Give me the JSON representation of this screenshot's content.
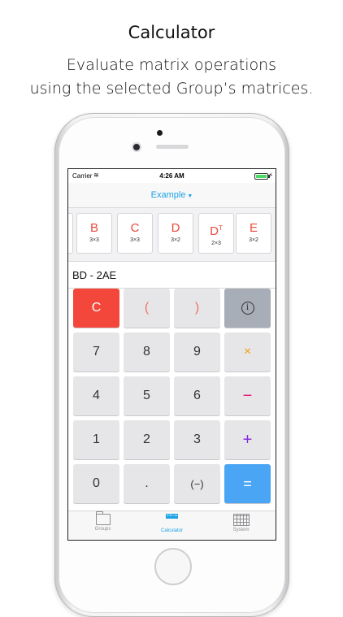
{
  "headline": {
    "title": "Calculator",
    "subtitle_line1": "Evaluate matrix operations",
    "subtitle_line2": "using the selected Group’s matrices."
  },
  "status_bar": {
    "carrier": "Carrier",
    "time": "4:26 AM"
  },
  "navbar": {
    "group_name": "Example"
  },
  "matrices": [
    {
      "name": "B",
      "sup": "",
      "dims": "3×3"
    },
    {
      "name": "C",
      "sup": "",
      "dims": "3×3"
    },
    {
      "name": "D",
      "sup": "",
      "dims": "3×2"
    },
    {
      "name": "D",
      "sup": "T",
      "dims": "2×3"
    },
    {
      "name": "E",
      "sup": "",
      "dims": "3×2"
    }
  ],
  "expression": "BD - 2AE",
  "keys": {
    "clear": "C",
    "open_paren": "(",
    "close_paren": ")",
    "info": "i",
    "seven": "7",
    "eight": "8",
    "nine": "9",
    "multiply": "×",
    "four": "4",
    "five": "5",
    "six": "6",
    "subtract": "−",
    "one": "1",
    "two": "2",
    "three": "3",
    "add": "+",
    "zero": "0",
    "decimal": ".",
    "negate": "(−)",
    "equals": "="
  },
  "tabs": {
    "groups": "Groups",
    "calculator": "Calculator",
    "system": "System",
    "active": "calculator"
  },
  "colors": {
    "accent": "#1aa1e6",
    "clear_key": "#f4473b",
    "equals_key": "#4aa6f5",
    "matrix_label": "#e84a3c"
  }
}
